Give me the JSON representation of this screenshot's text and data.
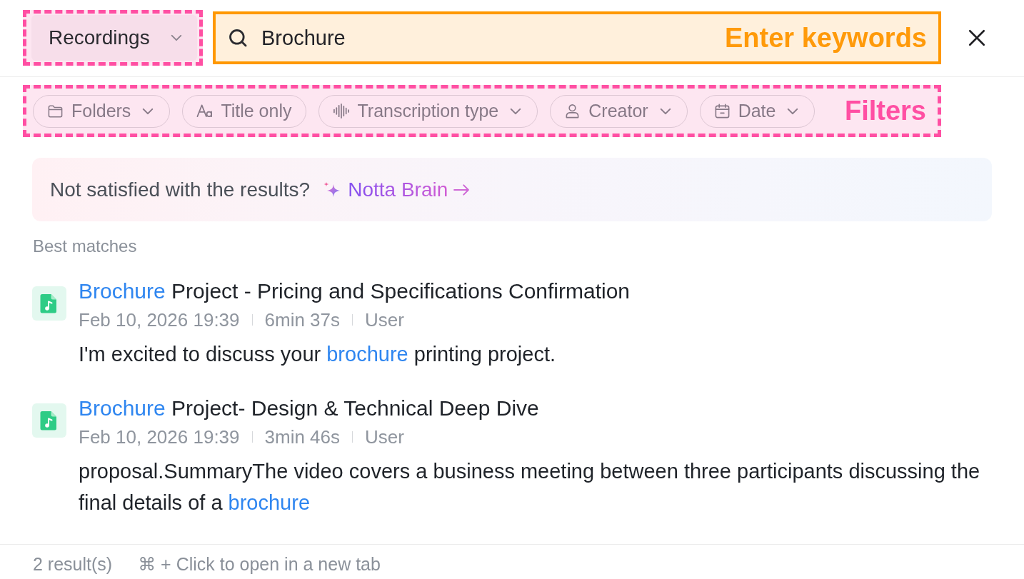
{
  "scope": {
    "label": "Recordings",
    "annotation": {
      "kind": "highlight"
    }
  },
  "search": {
    "value": "Brochure",
    "annotation": {
      "kind": "callout",
      "label": "Enter keywords"
    }
  },
  "filters": {
    "annotation": {
      "kind": "highlight",
      "label": "Filters"
    },
    "chips": [
      {
        "label": "Folders",
        "kind": "dropdown"
      },
      {
        "label": "Title only",
        "kind": "toggle",
        "selected": false
      },
      {
        "label": "Transcription type",
        "kind": "dropdown"
      },
      {
        "label": "Creator",
        "kind": "dropdown"
      },
      {
        "label": "Date",
        "kind": "dropdown"
      }
    ]
  },
  "banner": {
    "text": "Not satisfied with the results?",
    "link": "Notta Brain"
  },
  "results_heading": "Best matches",
  "results": [
    {
      "title": [
        {
          "text": "Brochure",
          "match": true
        },
        {
          "text": "Project - Pricing and Specifications Confirmation",
          "match": false
        }
      ],
      "date": "Feb 10, 2026 19:39",
      "duration": "6min 37s",
      "creator": "User",
      "snippet": [
        {
          "text": "I'm excited to discuss your",
          "match": false
        },
        {
          "text": "brochure",
          "match": true
        },
        {
          "text": "printing project.",
          "match": false
        }
      ]
    },
    {
      "title": [
        {
          "text": "Brochure",
          "match": true
        },
        {
          "text": "Project- Design & Technical Deep Dive",
          "match": false
        }
      ],
      "date": "Feb 10, 2026 19:39",
      "duration": "3min 46s",
      "creator": "User",
      "snippet": [
        {
          "text": "proposal.SummaryThe video covers a business meeting between three participants discussing the final details of a",
          "match": false
        },
        {
          "text": "brochure",
          "match": true
        }
      ]
    }
  ],
  "status_bar": {
    "count": "2 result(s)",
    "hint": "⌘ + Click to open in a new tab"
  }
}
